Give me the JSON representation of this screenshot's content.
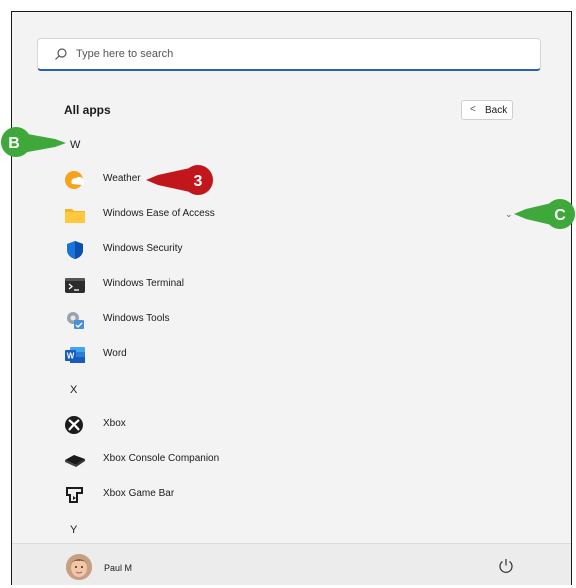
{
  "search": {
    "placeholder": "Type here to search"
  },
  "header": {
    "title": "All apps",
    "back_label": "Back",
    "back_chevron": "<"
  },
  "sections": [
    {
      "letter": "W",
      "apps": [
        {
          "name": "Weather",
          "icon": "weather-icon"
        },
        {
          "name": "Windows Ease of Access",
          "icon": "folder-icon"
        },
        {
          "name": "Windows Security",
          "icon": "shield-icon"
        },
        {
          "name": "Windows Terminal",
          "icon": "terminal-icon"
        },
        {
          "name": "Windows Tools",
          "icon": "tools-icon"
        },
        {
          "name": "Word",
          "icon": "word-icon"
        }
      ]
    },
    {
      "letter": "X",
      "apps": [
        {
          "name": "Xbox",
          "icon": "xbox-icon"
        },
        {
          "name": "Xbox Console Companion",
          "icon": "xbox-console-icon"
        },
        {
          "name": "Xbox Game Bar",
          "icon": "game-bar-icon"
        }
      ]
    },
    {
      "letter": "Y",
      "apps": []
    }
  ],
  "user": {
    "name": "Paul M"
  },
  "annotations": {
    "b": "B",
    "three": "3",
    "c": "C"
  },
  "colors": {
    "accent": "#2b5fb4",
    "callout_green": "#3fa83a",
    "callout_red": "#c0161c"
  }
}
